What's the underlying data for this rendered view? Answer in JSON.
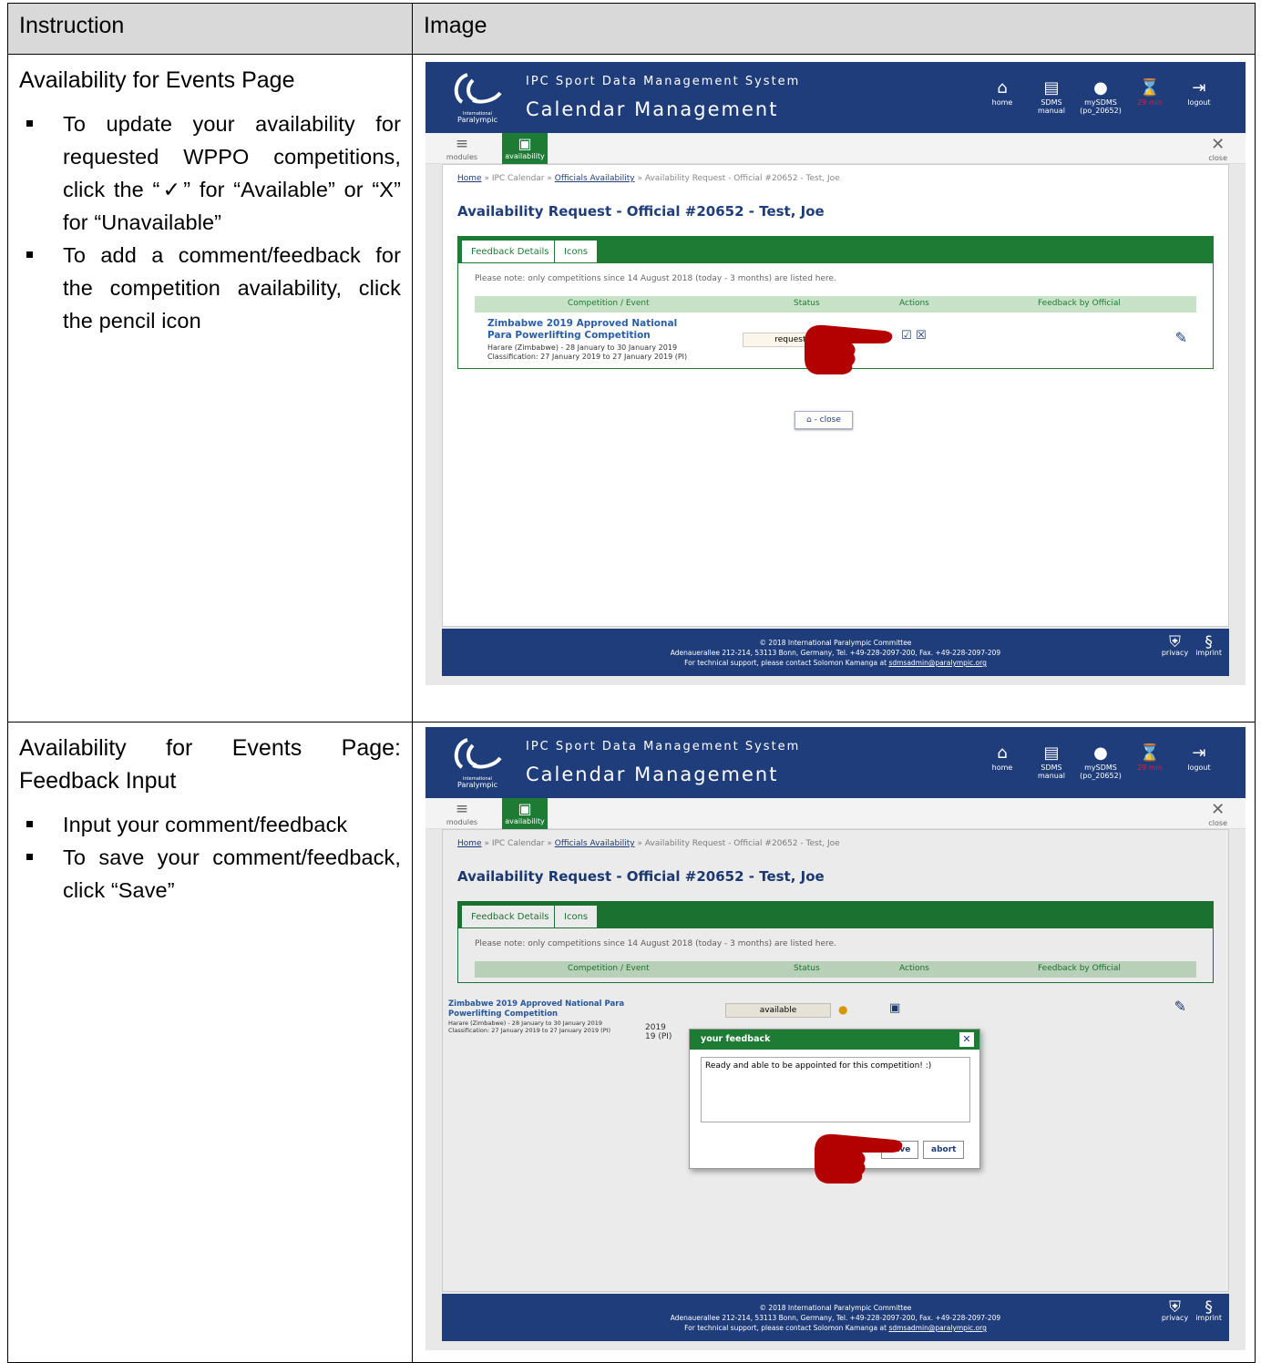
{
  "headers": {
    "instruction": "Instruction",
    "image": "Image"
  },
  "sections": [
    {
      "title": "Availability for Events Page",
      "bullets": [
        "To update your availability for requested WPPO competitions, click the “✓” for “Available” or “X” for “Unavailable”",
        "To add a comment/feedback for the competition availability, click the pencil icon"
      ]
    },
    {
      "title": "Availability for Events Page: Feedback Input",
      "bullets": [
        "Input your comment/feedback",
        "To save your comment/feedback, click “Save”"
      ]
    }
  ],
  "app": {
    "logo_text": "International Paralympic Committee",
    "system_name": "IPC Sport Data Management System",
    "app_name": "Calendar Management",
    "nav": {
      "home": "home",
      "manual": "SDMS manual",
      "my": "mySDMS",
      "my_user": "(po_20652)",
      "timer": "29 min",
      "logout": "logout"
    },
    "toolbar": {
      "modules": "modules",
      "availability": "availability",
      "close": "close"
    },
    "crumb": {
      "home": "Home",
      "calendar": "IPC Calendar",
      "officials": "Officials Availability",
      "current": "Availability Request - Official #20652 - Test, Joe"
    },
    "page_title": "Availability Request - Official #20652 - Test, Joe",
    "tabs": [
      "Feedback Details",
      "Icons"
    ],
    "note": "Please note: only competitions since 14 August 2018 (today - 3 months) are listed here.",
    "columns": [
      "Competition / Event",
      "Status",
      "Actions",
      "Feedback by Official"
    ],
    "competition": {
      "name": "Zimbabwe 2019 Approved National Para Powerlifting Competition",
      "venue": "Harare (Zimbabwe) - 28 January to 30 January 2019",
      "classification": "Classification: 27 January 2019 to 27 January 2019 (PI)"
    },
    "status_requested": "requested",
    "status_available": "available",
    "close_button": "- close",
    "footer": {
      "copyright": "© 2018 International Paralympic Committee",
      "address": "Adenauerallee 212-214, 53113 Bonn, Germany, Tel. +49-228-2097-200, Fax. +49-228-2097-209",
      "support": "For technical support, please contact Solomon Kamanga at",
      "email": "sdmsadmin@paralympic.org",
      "privacy": "privacy",
      "imprint": "imprint"
    },
    "modal": {
      "title": "your feedback",
      "text": "Ready and able to be appointed for this competition! :)",
      "save": "save",
      "abort": "abort",
      "partial_year": "2019",
      "partial_cls": "19 (PI)"
    }
  },
  "colors": {
    "brand_blue": "#1f3d7a",
    "brand_green": "#1e7b34",
    "timer_red": "#e01e37"
  }
}
